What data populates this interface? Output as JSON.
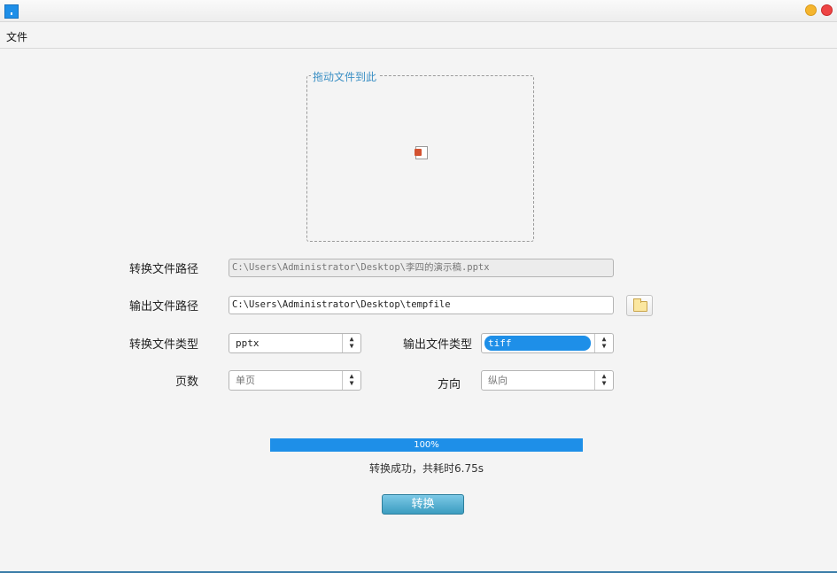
{
  "menu": {
    "file": "文件"
  },
  "dropzone": {
    "label": "拖动文件到此",
    "file_icon": "pptx-file-icon"
  },
  "form": {
    "convert_path_label": "转换文件路径",
    "convert_path_value": "C:\\Users\\Administrator\\Desktop\\李四的演示稿.pptx",
    "output_path_label": "输出文件路径",
    "output_path_value": "C:\\Users\\Administrator\\Desktop\\tempfile",
    "convert_type_label": "转换文件类型",
    "convert_type_value": "pptx",
    "output_type_label": "输出文件类型",
    "output_type_value": "tiff",
    "pages_label": "页数",
    "pages_value": "单页",
    "orientation_label": "方向",
    "orientation_value": "纵向"
  },
  "progress": {
    "percent": 100,
    "label": "100%"
  },
  "status": "转换成功，共耗时6.75s",
  "convert_button": "转换",
  "colors": {
    "accent": "#1e8fe8",
    "button": "#3b9dc0"
  }
}
